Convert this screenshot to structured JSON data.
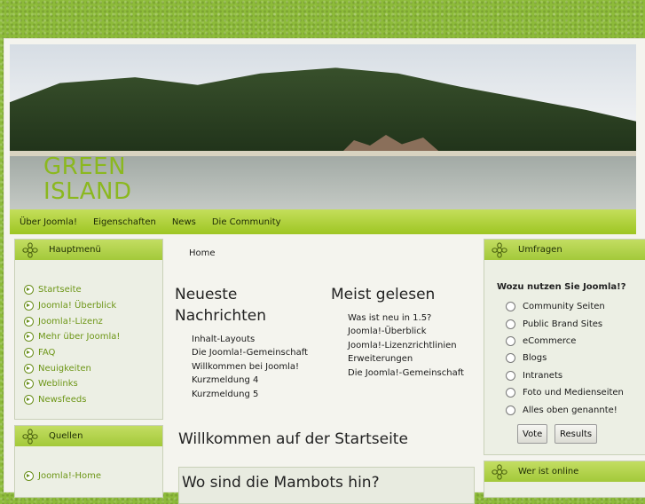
{
  "site": {
    "title": "GREEN ISLAND"
  },
  "topnav": [
    "Über Joomla!",
    "Eigenschaften",
    "News",
    "Die Community"
  ],
  "left": {
    "mainmenu": {
      "title": "Hauptmenü",
      "items": [
        "Startseite",
        "Joomla! Überblick",
        "Joomla!-Lizenz",
        "Mehr über Joomla!",
        "FAQ",
        "Neuigkeiten",
        "Weblinks",
        "Newsfeeds"
      ]
    },
    "resources": {
      "title": "Quellen",
      "items": [
        "Joomla!-Home"
      ]
    }
  },
  "main": {
    "breadcrumb": "Home",
    "latest": {
      "title": "Neueste Nachrichten",
      "items": [
        "Inhalt-Layouts",
        "Die Joomla!-Gemeinschaft",
        "Willkommen bei Joomla!",
        "Kurzmeldung 4",
        "Kurzmeldung 5"
      ]
    },
    "popular": {
      "title": "Meist gelesen",
      "items": [
        "Was ist neu in 1.5?",
        "Joomla!-Überblick",
        "Joomla!-Lizenzrichtlinien",
        "Erweiterungen",
        "Die Joomla!-Gemeinschaft"
      ]
    },
    "welcome": "Willkommen auf der Startseite",
    "article_title": "Wo sind die Mambots hin?"
  },
  "right": {
    "polls": {
      "title": "Umfragen",
      "question": "Wozu nutzen Sie Joomla!?",
      "options": [
        "Community Seiten",
        "Public Brand Sites",
        "eCommerce",
        "Blogs",
        "Intranets",
        "Foto und Medienseiten",
        "Alles oben genannte!"
      ],
      "vote_label": "Vote",
      "results_label": "Results"
    },
    "online": {
      "title": "Wer ist online"
    }
  },
  "colors": {
    "accent": "#a3c93a",
    "link": "#6d9617",
    "title": "#8bb81f"
  },
  "icons": {
    "box_header": "gear-flower-icon",
    "menu_bullet": "arrow-circle-icon",
    "poll_choice": "radio-icon"
  }
}
